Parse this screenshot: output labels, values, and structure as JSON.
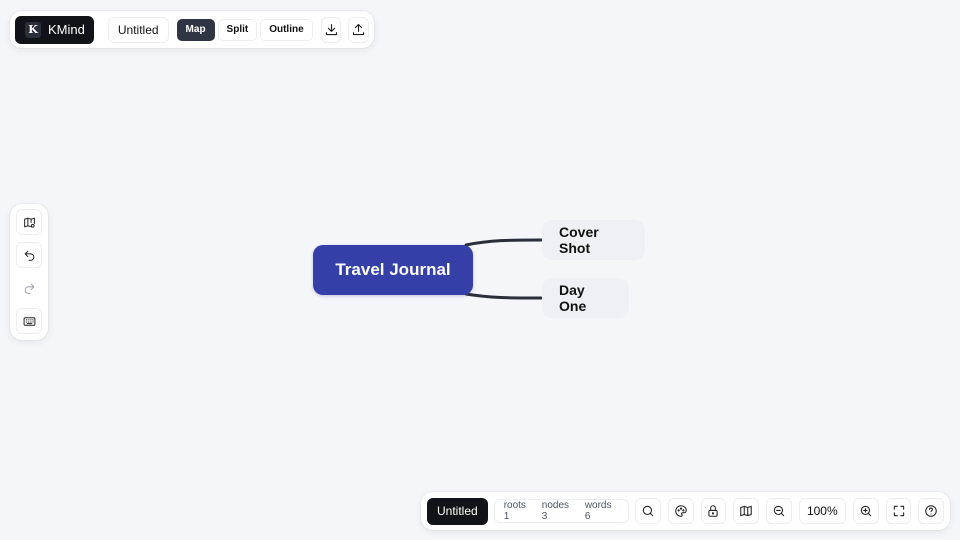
{
  "app": {
    "brand_letter": "K",
    "brand_name": "KMind",
    "doc_title": "Untitled"
  },
  "toolbar": {
    "modes": [
      {
        "label": "Map",
        "active": true
      },
      {
        "label": "Split",
        "active": false
      },
      {
        "label": "Outline",
        "active": false
      }
    ],
    "icons": [
      "download-icon",
      "upload-icon"
    ]
  },
  "left_toolbar": {
    "icons": [
      "map-settings-icon",
      "undo-icon",
      "redo-icon",
      "keyboard-icon"
    ]
  },
  "mindmap": {
    "root": {
      "label": "Travel Journal",
      "color": "#3440a8"
    },
    "children": [
      {
        "label": "Cover Shot"
      },
      {
        "label": "Day One"
      }
    ]
  },
  "status_bar": {
    "doc_title": "Untitled",
    "stats": {
      "roots": "roots 1",
      "nodes": "nodes 3",
      "words": "words 6"
    },
    "zoom": "100%",
    "icons": [
      "search-icon",
      "theme-palette-icon",
      "lock-icon",
      "minimap-icon",
      "zoom-out-icon",
      "zoom-in-icon",
      "fullscreen-icon",
      "help-icon"
    ]
  },
  "colors": {
    "background": "#f5f6fa",
    "brand_dark": "#111318",
    "root_node": "#3440a8",
    "child_node": "#eef0f6"
  }
}
